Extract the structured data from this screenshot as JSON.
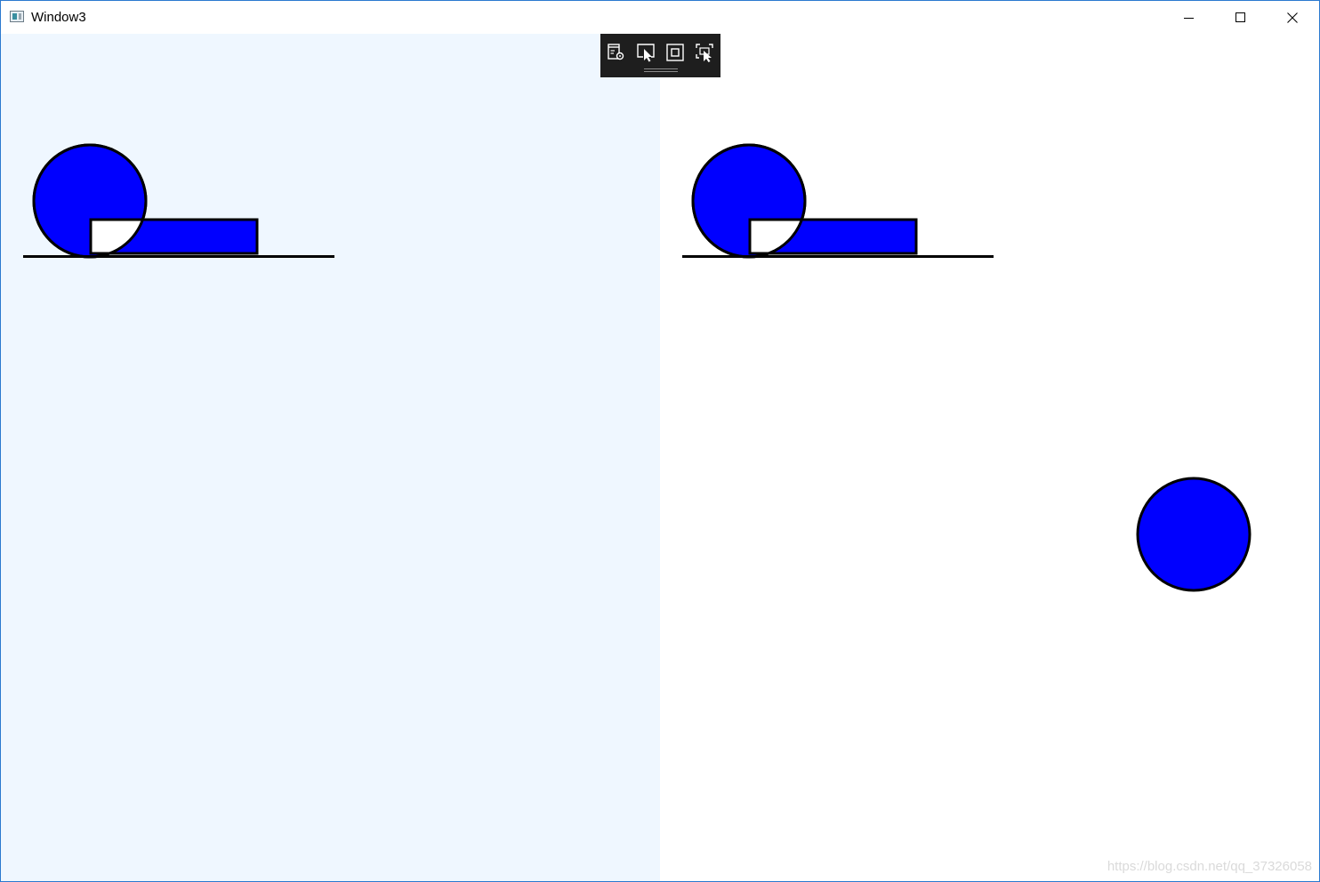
{
  "window": {
    "title": "Window3"
  },
  "caption_buttons": {
    "minimize": "minimize-icon",
    "maximize": "maximize-icon",
    "close": "close-icon"
  },
  "debug_toolbar": {
    "tools": [
      "live-visual-tree-icon",
      "select-element-icon",
      "display-layout-adorners-icon",
      "track-focused-element-icon"
    ]
  },
  "panels": {
    "left_background": "#eff7ff",
    "right_background": "#ffffff"
  },
  "shapes": {
    "fill": "#0000ff",
    "stroke": "#000000"
  },
  "watermark": "https://blog.csdn.net/qq_37326058"
}
